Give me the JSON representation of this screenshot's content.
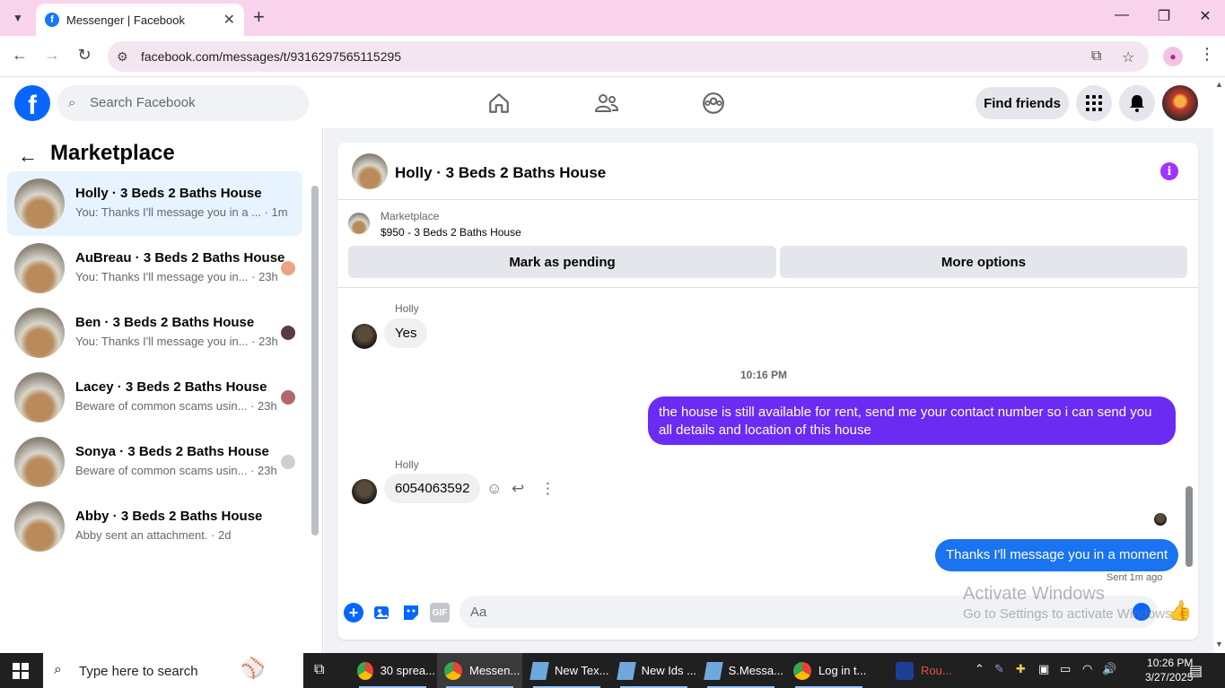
{
  "browser": {
    "tab_title": "Messenger | Facebook",
    "url": "facebook.com/messages/t/9316297565115295"
  },
  "fb_header": {
    "search_placeholder": "Search Facebook",
    "find_friends": "Find friends"
  },
  "left_panel": {
    "title": "Marketplace",
    "threads": [
      {
        "name": "Holly · 3 Beds 2 Baths House",
        "snippet": "You: Thanks I'll message you in a ... · 1m",
        "active": true
      },
      {
        "name": "AuBreau · 3 Beds 2 Baths House",
        "snippet": "You: Thanks I'll message you in... · 23h",
        "active": false
      },
      {
        "name": "Ben · 3 Beds 2 Baths House",
        "snippet": "You: Thanks I'll message you in... · 23h",
        "active": false
      },
      {
        "name": "Lacey · 3 Beds 2 Baths House",
        "snippet": "Beware of common scams usin... · 23h",
        "active": false
      },
      {
        "name": "Sonya · 3 Beds 2 Baths House",
        "snippet": "Beware of common scams usin... · 23h",
        "active": false
      },
      {
        "name": "Abby · 3 Beds 2 Baths House",
        "snippet": "Abby sent an attachment. · 2d",
        "active": false
      }
    ]
  },
  "chat": {
    "title": "Holly · 3 Beds 2 Baths House",
    "marketplace_label": "Marketplace",
    "listing": "$950 - 3 Beds 2 Baths House",
    "mark_pending": "Mark as pending",
    "more_options": "More options",
    "messages": [
      {
        "sender": "Holly",
        "text": "Yes"
      },
      {
        "timestamp": "10:16 PM"
      },
      {
        "sender": "You",
        "text": "the house is still available for rent, send me your contact number so i can send you all details and location of this house"
      },
      {
        "sender": "Holly",
        "text": "6054063592"
      },
      {
        "sender": "You",
        "text": "Thanks I'll message you in a moment"
      }
    ],
    "sent_info": "Sent 1m ago",
    "compose_placeholder": "Aa",
    "gif_label": "GIF"
  },
  "watermark": {
    "line1": "Activate Windows",
    "line2": "Go to Settings to activate Windows."
  },
  "taskbar": {
    "search_text": "Type here to search",
    "items": [
      "30 sprea...",
      "Messen...",
      "New Tex...",
      "New Ids ...",
      "S.Messa...",
      "Log in t...",
      "Rou..."
    ],
    "time": "10:26 PM",
    "date": "3/27/2025"
  },
  "colors": {
    "fb_blue": "#0866ff",
    "bubble_purple": "#6b2bf2",
    "bubble_blue": "#1a73f0",
    "active_thread": "#e7f3ff"
  }
}
